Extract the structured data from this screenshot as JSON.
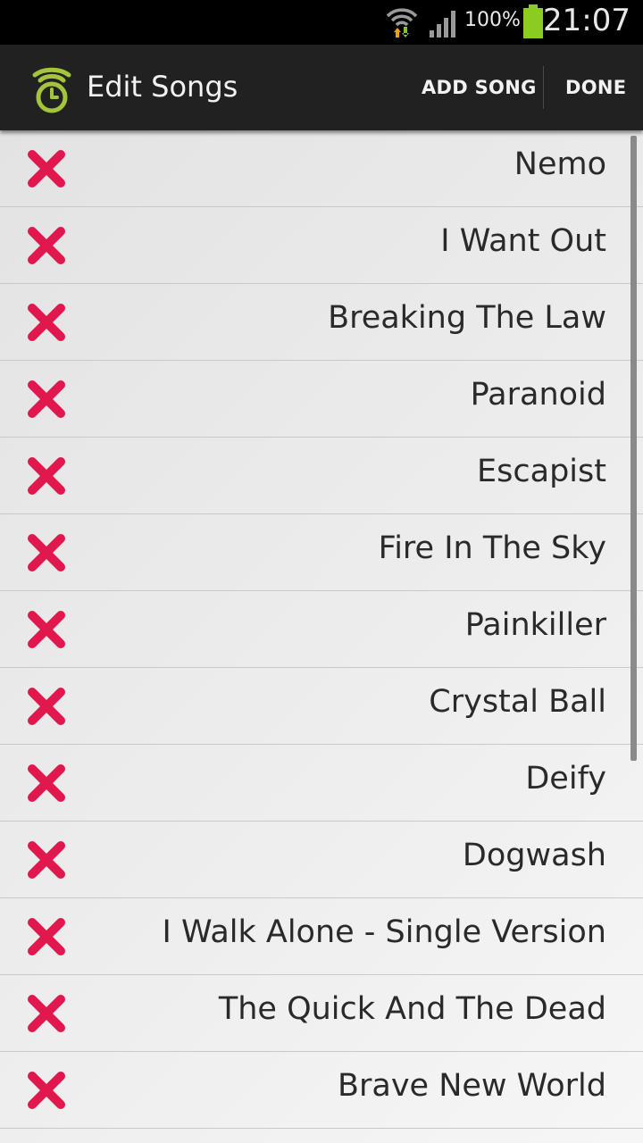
{
  "status_bar": {
    "battery_percent": "100%",
    "time": "21:07",
    "icons": [
      "wifi-icon",
      "signal-icon",
      "battery-icon"
    ]
  },
  "action_bar": {
    "title": "Edit Songs",
    "icon": "app-timer-icon",
    "add_song_label": "ADD SONG",
    "done_label": "DONE"
  },
  "songs": [
    "Nemo",
    "I Want Out",
    "Breaking The Law",
    "Paranoid",
    "Escapist",
    "Fire In The Sky",
    "Painkiller",
    "Crystal Ball",
    "Deify",
    "Dogwash",
    "I Walk Alone - Single Version",
    "The Quick And The Dead",
    "Brave New World"
  ],
  "colors": {
    "delete_icon": "#e0184e",
    "app_icon": "#a4c43c",
    "battery": "#8ccc22",
    "action_bar": "#212121"
  }
}
